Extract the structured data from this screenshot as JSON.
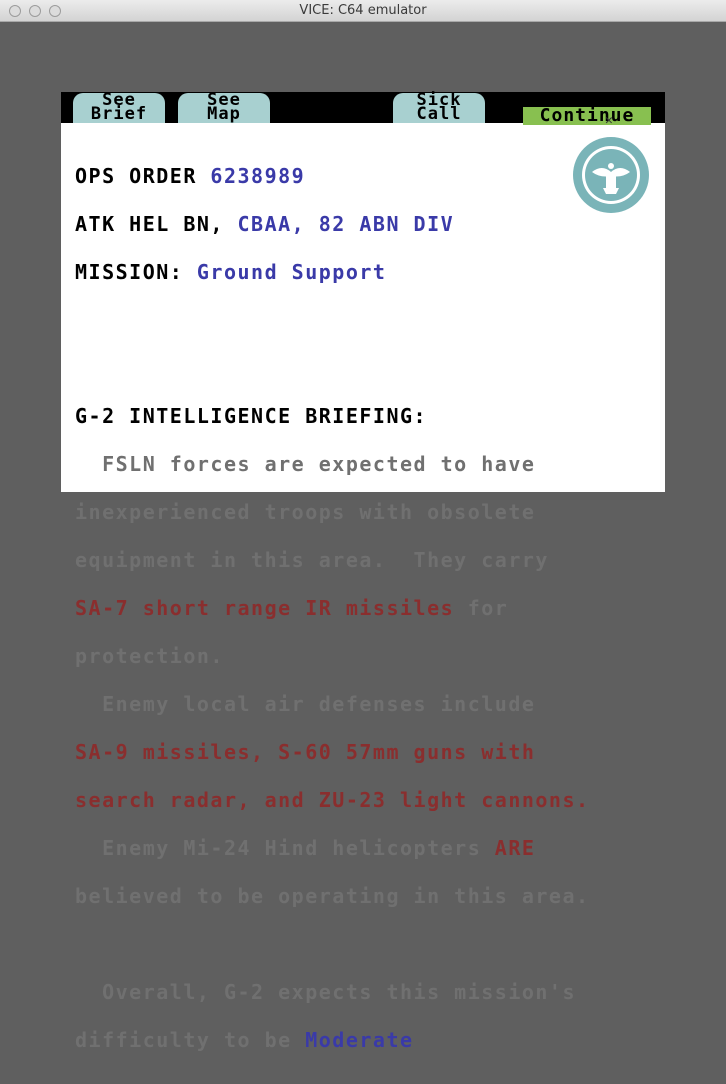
{
  "window": {
    "title": "VICE: C64 emulator"
  },
  "menu": {
    "see_brief": [
      "See",
      "Brief"
    ],
    "see_map": [
      "See",
      "Map"
    ],
    "sick_call": [
      "Sick",
      "Call"
    ],
    "continue": "Continue"
  },
  "header": {
    "ops_order_label": "OPS ORDER ",
    "ops_order_value": "6238989",
    "unit_label": "ATK HEL BN, ",
    "unit_value": "CBAA, 82 ABN DIV",
    "mission_label": "MISSION: ",
    "mission_value": "Ground Support"
  },
  "briefing": {
    "title": "G-2 INTELLIGENCE BRIEFING:",
    "l1": "  FSLN forces are expected to have",
    "l2": "inexperienced troops with obsolete",
    "l3": "equipment in this area.  They carry",
    "l4a": "SA-7 short range IR missiles",
    "l4b": " for",
    "l5": "protection.",
    "l6": "  Enemy local air defenses include",
    "l7": "SA-9 missiles, S-60 57mm guns with",
    "l8": "search radar, and ZU-23 light cannons.",
    "l9a": "  Enemy Mi-24 Hind helicopters ",
    "l9b": "ARE",
    "l10": "believed to be operating in this area.",
    "l11": "  Overall, G-2 expects this mission's",
    "l12a": "difficulty to be ",
    "l12b": "Moderate"
  },
  "colors": {
    "tab": "#a8d0d0",
    "continue": "#88c050",
    "blue_text": "#3a3aa8",
    "red_text": "#8a2e2e",
    "grey_text": "#707070"
  }
}
